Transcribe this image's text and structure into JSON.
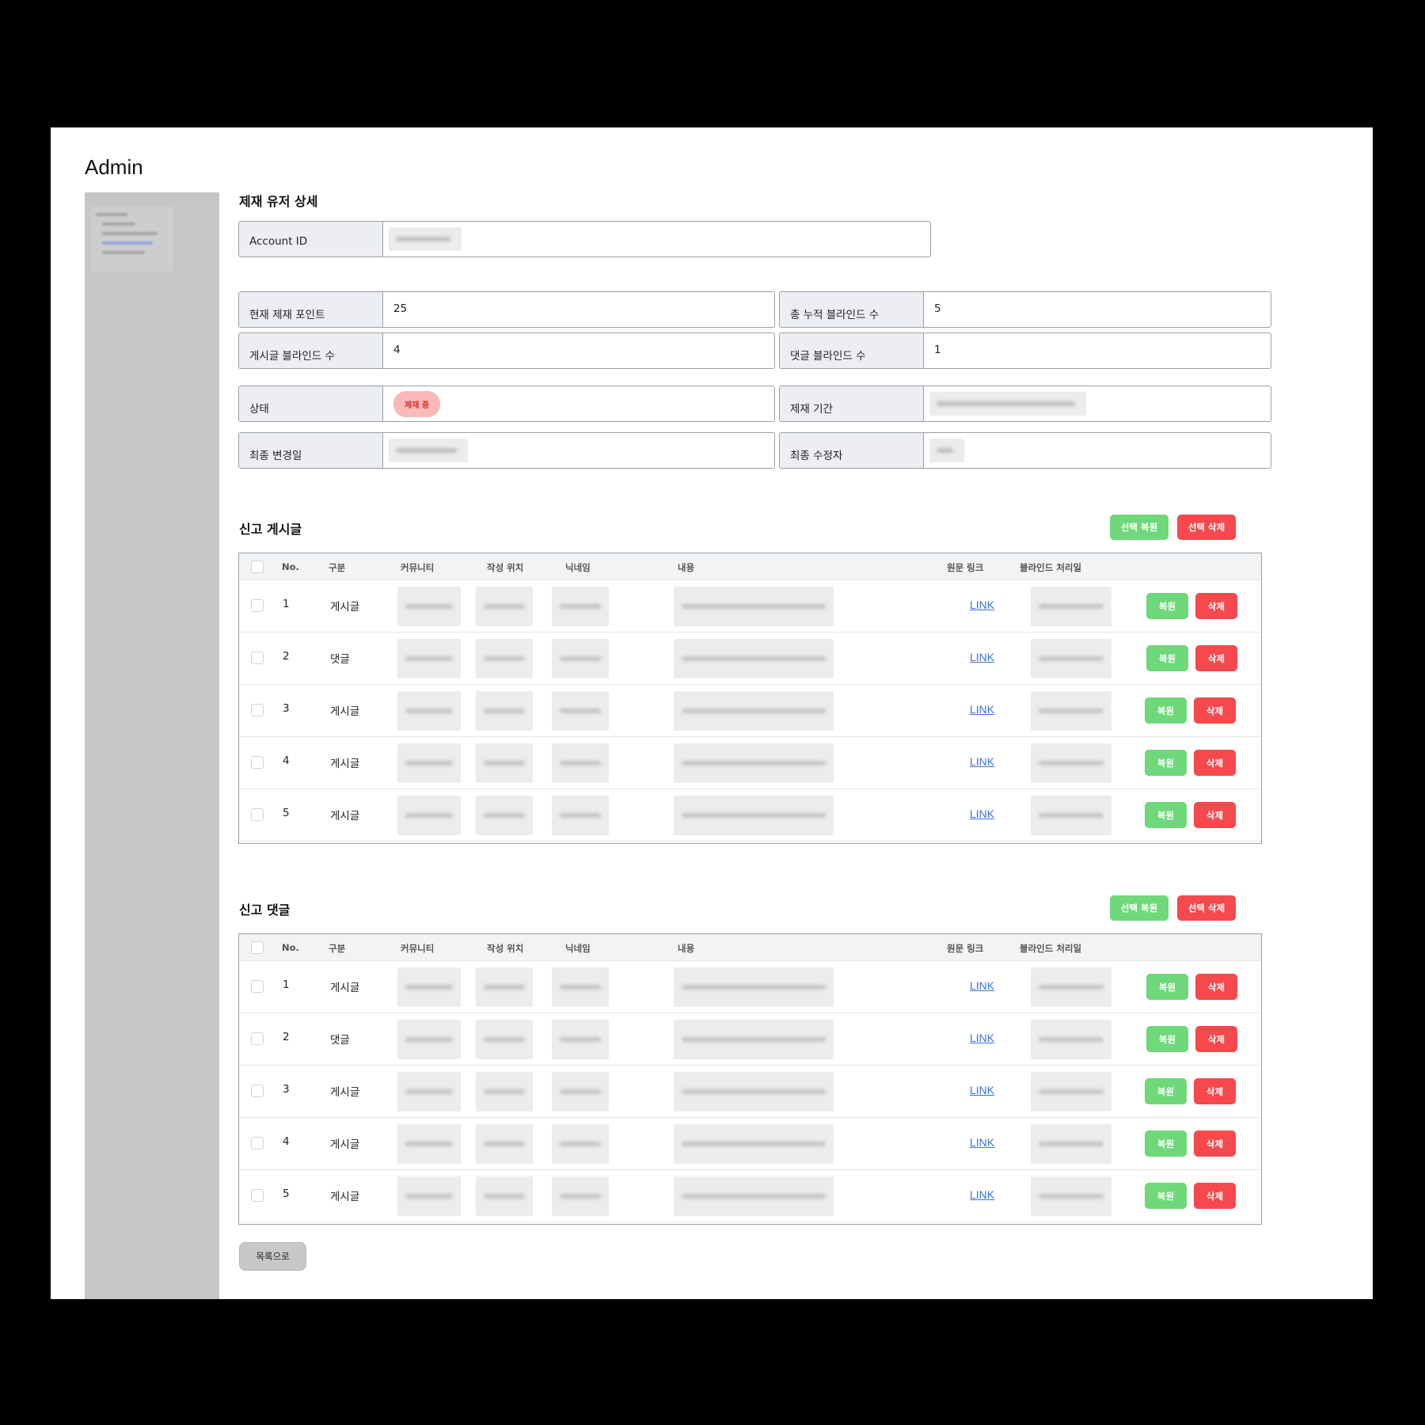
{
  "app": {
    "title": "Admin"
  },
  "detail": {
    "title": "제재 유저 상세",
    "account_id_label": "Account ID",
    "points_label": "현재 제재 포인트",
    "points_value": "25",
    "total_blind_label": "총 누적 블라인드 수",
    "total_blind_value": "5",
    "post_blind_label": "게시글 블라인드 수",
    "post_blind_value": "4",
    "comment_blind_label": "댓글 블라인드 수",
    "comment_blind_value": "1",
    "status_label": "상태",
    "status_value": "제재 중",
    "period_label": "제재 기간",
    "last_changed_label": "최종 변경일",
    "last_editor_label": "최종 수정자"
  },
  "reported_posts": {
    "title": "신고 게시글",
    "restore_selected": "선택 복원",
    "delete_selected": "선택 삭제",
    "columns": [
      "No.",
      "구분",
      "커뮤니티",
      "작성 위치",
      "닉네임",
      "내용",
      "원문 링크",
      "블라인드 처리일"
    ],
    "rows": [
      {
        "no": "1",
        "type": "게시글",
        "link": "LINK",
        "restore": "복원",
        "delete": "삭제"
      },
      {
        "no": "2",
        "type": "댓글",
        "link": "LINK",
        "restore": "복원",
        "delete": "삭제"
      },
      {
        "no": "3",
        "type": "게시글",
        "link": "LINK",
        "restore": "복원",
        "delete": "삭제"
      },
      {
        "no": "4",
        "type": "게시글",
        "link": "LINK",
        "restore": "복원",
        "delete": "삭제"
      },
      {
        "no": "5",
        "type": "게시글",
        "link": "LINK",
        "restore": "복원",
        "delete": "삭제"
      }
    ]
  },
  "reported_comments": {
    "title": "신고 댓글",
    "restore_selected": "선택 복원",
    "delete_selected": "선택 삭제",
    "columns": [
      "No.",
      "구분",
      "커뮤니티",
      "작성 위치",
      "닉네임",
      "내용",
      "원문 링크",
      "블라인드 처리일"
    ],
    "rows": [
      {
        "no": "1",
        "type": "게시글",
        "link": "LINK",
        "restore": "복원",
        "delete": "삭제"
      },
      {
        "no": "2",
        "type": "댓글",
        "link": "LINK",
        "restore": "복원",
        "delete": "삭제"
      },
      {
        "no": "3",
        "type": "게시글",
        "link": "LINK",
        "restore": "복원",
        "delete": "삭제"
      },
      {
        "no": "4",
        "type": "게시글",
        "link": "LINK",
        "restore": "복원",
        "delete": "삭제"
      },
      {
        "no": "5",
        "type": "게시글",
        "link": "LINK",
        "restore": "복원",
        "delete": "삭제"
      }
    ]
  },
  "footer": {
    "back_label": "목록으로"
  },
  "colors": {
    "restore": "#6fd87a",
    "delete": "#f5494d",
    "status_pill_bg": "#f9b9b9",
    "status_pill_text": "#d62c2c",
    "link": "#3a72d8"
  }
}
